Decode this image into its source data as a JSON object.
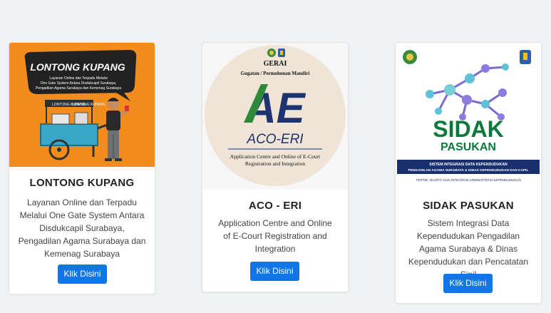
{
  "cards": [
    {
      "image": {
        "banner_title": "LONTONG KUPANG",
        "banner_line1": "Layanan Online dan Terpadu Melalui",
        "banner_line2": "One Gate System Antara Disdukcapil Surabaya,",
        "banner_line3": "Pengadilan Agama Surabaya dan Kemenag Surabaya",
        "cart_sign": "LONTONG KUPANG"
      },
      "title": "LONTONG KUPANG",
      "description": "Layanan Online dan Terpadu Melalui One Gate System Antara Disdukcapil Surabaya, Pengadilan Agama Surabaya dan Kemenag Surabaya",
      "button": "Klik Disini"
    },
    {
      "image": {
        "brand": "GERAI",
        "subtitle": "Gugatan / Permohonan Mandiri",
        "logo_text": "AE",
        "name": "ACO-ERI",
        "tagline_line1": "Application Centre and Online of E-Court",
        "tagline_line2": "Registration and Integration"
      },
      "title": "ACO - ERI",
      "description": "Application Centre and Online of E-Court Registration and Integration",
      "button": "Klik Disini"
    },
    {
      "image": {
        "line1": "SIDAK",
        "line2": "PASUKAN",
        "banner_line1": "SISTEM INTEGRASI DATA KEPENDUDUKAN",
        "banner_line2": "PENGADILAN AGAMA SURABAYA & DINAS KEPENDUDUKAN DAN CAPIL",
        "footer": "TERTIB, AKURAT DAN INTEGRASI ADMINISTRASI KEPENDUDUKAN"
      },
      "title": "SIDAK PASUKAN",
      "description": "Sistem Integrasi Data Kependudukan Pengadilan Agama Surabaya & Dinas Kependudukan dan Pencatatan Sipil",
      "button": "Klik Disini"
    }
  ],
  "colors": {
    "button": "#1177e6",
    "lontong_bg": "#f28c1c",
    "sidak_green": "#0a7a3b",
    "aco_green": "#2e8a3a",
    "aco_navy": "#1e3470"
  }
}
